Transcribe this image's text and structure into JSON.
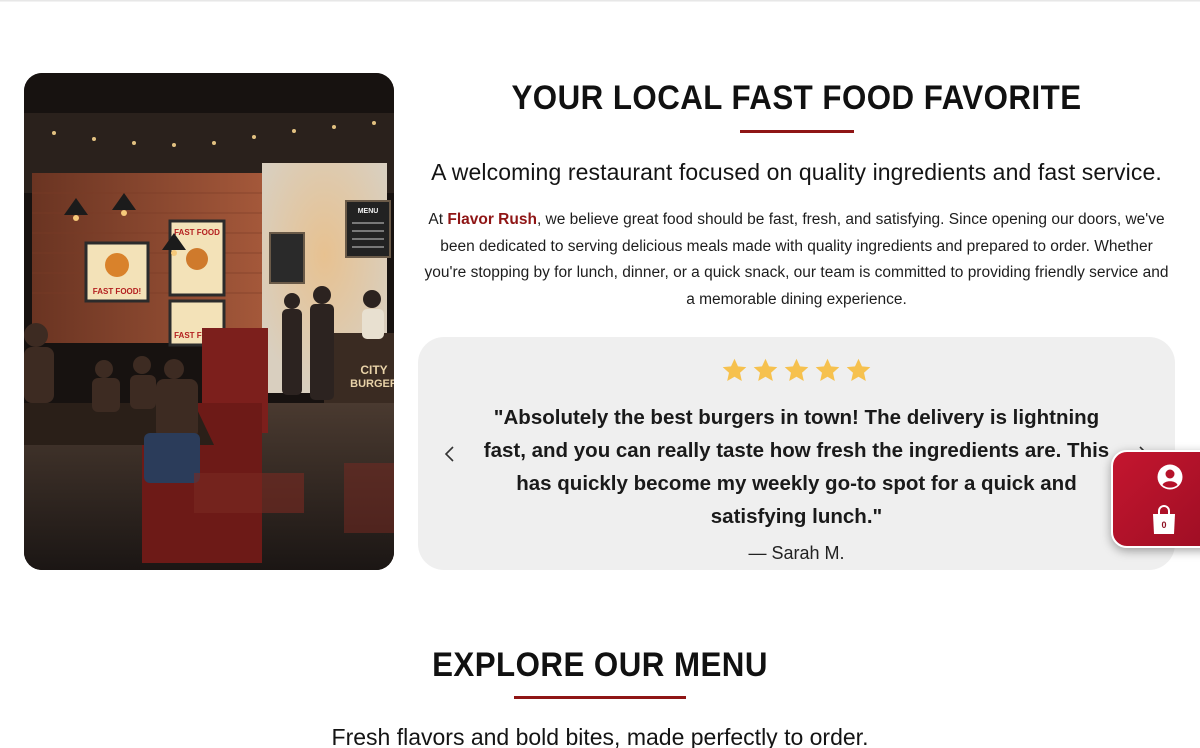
{
  "about": {
    "title": "YOUR LOCAL FAST FOOD FAVORITE",
    "subtitle": "A welcoming restaurant focused on quality ingredients and fast service.",
    "body_prefix": "At ",
    "brand": "Flavor Rush",
    "body_suffix": ", we believe great food should be fast, fresh, and satisfying. Since opening our doors, we've been dedicated to serving delicious meals made with quality ingredients and prepared to order. Whether you're stopping by for lunch, dinner, or a quick snack, our team is committed to providing friendly service and a memorable dining experience."
  },
  "photo": {
    "poster_left": "FAST FOOD!",
    "poster_right": "FAST FOOD",
    "menu_board": "MENU",
    "window_sign_1": "CITY",
    "window_sign_2": "BURGER"
  },
  "review": {
    "rating": 5,
    "star_color": "#f6c14e",
    "quote": "\"Absolutely the best burgers in town! The delivery is lightning fast, and you can really taste how fresh the ingredients are. This has quickly become my weekly go-to spot for a quick and satisfying lunch.\"",
    "author": "— Sarah M.",
    "prev_icon": "chevron-left-icon",
    "next_icon": "chevron-right-icon"
  },
  "widget": {
    "user_icon": "user-icon",
    "bag_icon": "shopping-bag-icon",
    "cart_count": "0",
    "color": "#b5122a"
  },
  "menu_section": {
    "title": "EXPLORE OUR MENU",
    "subtitle": "Fresh flavors and bold bites, made perfectly to order."
  },
  "colors": {
    "accent": "#8f1515",
    "card_bg": "#efefef"
  }
}
